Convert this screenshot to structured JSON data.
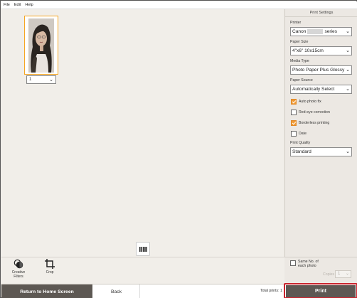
{
  "menu": [
    "File",
    "Edit",
    "Help"
  ],
  "thumbnail": {
    "copies": "1"
  },
  "tools": {
    "creative_filters": "Creative Filters",
    "crop": "Crop"
  },
  "settings": {
    "title": "Print Settings",
    "printer_label": "Printer",
    "printer_value_prefix": "Canon",
    "printer_value_suffix": "series",
    "paper_size_label": "Paper Size",
    "paper_size_value": "4\"x6\" 10x15cm",
    "media_type_label": "Media Type",
    "media_type_value": "Photo Paper Plus Glossy",
    "paper_source_label": "Paper Source",
    "paper_source_value": "Automatically Select",
    "auto_photo_fix": {
      "label": "Auto photo fix",
      "checked": true
    },
    "red_eye": {
      "label": "Red-eye correction",
      "checked": false
    },
    "borderless": {
      "label": "Borderless printing",
      "checked": true
    },
    "date": {
      "label": "Date",
      "checked": false
    },
    "print_quality_label": "Print Quality",
    "print_quality_value": "Standard"
  },
  "same_no": {
    "label": "Same No. of each photo",
    "checked": false
  },
  "copies_label": "Copies",
  "copies_value": "1",
  "footer": {
    "home_label": "Return to Home Screen",
    "back_label": "Back",
    "total_prints_label": "Total prints:",
    "total_prints_value": "1",
    "print_label": "Print"
  },
  "colors": {
    "accent": "#f09a34",
    "dark_button": "#5d5853",
    "highlight": "#c9232c"
  }
}
